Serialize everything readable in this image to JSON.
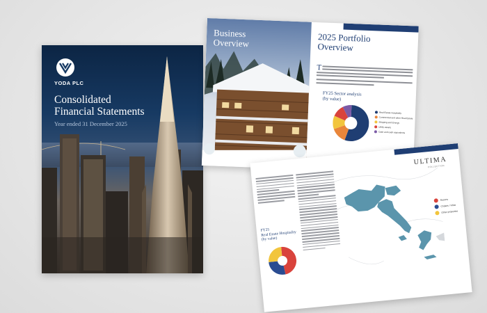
{
  "colors": {
    "navy": "#1f3e73",
    "map_land": "#5b95ac",
    "red": "#d9433c",
    "orange": "#e9863a",
    "yellow": "#f2c53d",
    "purple": "#7b5aa6",
    "blue": "#2a4c91"
  },
  "cover": {
    "logo_icon": "yoda-v-logo-icon",
    "company": "YODA PLC",
    "title_line1": "Consolidated",
    "title_line2": "Financial Statements",
    "subtitle": "Year ended 31 December 2025"
  },
  "spread": {
    "left_title_line1": "Business",
    "left_title_line2": "Overview",
    "right_title_line1": "2025 Portfolio",
    "right_title_line2": "Overview",
    "dropcap": "T",
    "sector_title_line1": "FY25 Sector analysis",
    "sector_title_line2": "(by value)",
    "legend": [
      {
        "label": "Real Estate Hospitality",
        "color": "#1f3e73"
      },
      {
        "label": "Commercial and other Real Estate",
        "color": "#e9863a"
      },
      {
        "label": "Shipping and Energy",
        "color": "#f2c53d"
      },
      {
        "label": "Utility assets",
        "color": "#d9433c"
      },
      {
        "label": "Cash and cash equivalents",
        "color": "#7b5aa6"
      }
    ],
    "pie_values": [
      0.55,
      0.14,
      0.12,
      0.11,
      0.08
    ]
  },
  "map_page": {
    "brand": "ULTIMA",
    "brand_sub": "COLLECTION",
    "fy_title_line1": "FY25",
    "fy_title_line2": "Real Estate Hospitality",
    "fy_title_line3": "(by value)",
    "pie_values": [
      0.48,
      0.27,
      0.25
    ],
    "legend": [
      {
        "label": "Resorts",
        "color": "#d9433c"
      },
      {
        "label": "Chalets / Villas",
        "color": "#2a4c91"
      },
      {
        "label": "Other properties",
        "color": "#f2c53d"
      }
    ]
  }
}
